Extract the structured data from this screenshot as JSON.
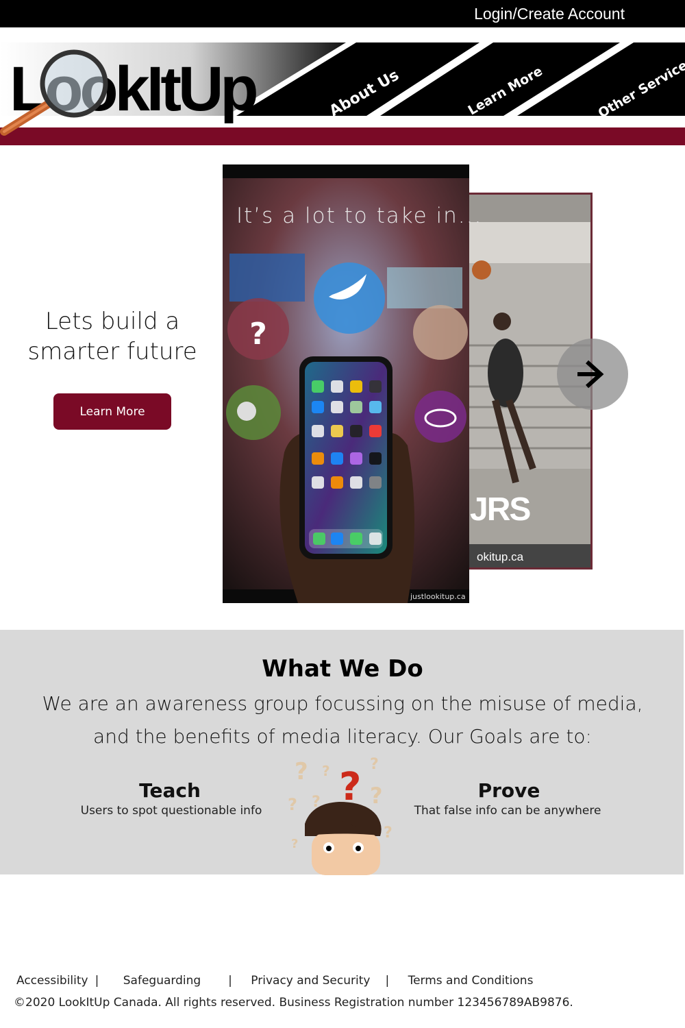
{
  "topbar": {
    "login_label": "Login/Create Account"
  },
  "header": {
    "logo_text": "LookItUp",
    "nav": [
      {
        "label": "About Us"
      },
      {
        "label": "Learn More"
      },
      {
        "label": "Other Services"
      }
    ],
    "accent_color": "#7a0a26"
  },
  "hero": {
    "headline_line1": "Lets build a",
    "headline_line2": "smarter future",
    "button_label": "Learn More",
    "slide_caption": "It’s a lot to take in...",
    "slide_watermark": "justlookitup.ca",
    "slide_back_text": "JRS",
    "slide_back_url": "okitup.ca",
    "next_icon": "arrow-right-icon"
  },
  "what_we_do": {
    "title": "What We Do",
    "text_line1": "We are an awareness group focussing on the misuse of media,",
    "text_line2": "and the benefits of media literacy. Our Goals are to:",
    "goals": [
      {
        "title": "Teach",
        "desc": "Users to spot questionable info"
      },
      {
        "title": "Prove",
        "desc": "That false info can be anywhere"
      }
    ]
  },
  "footer": {
    "links": [
      "Accessibility",
      "Safeguarding",
      "Privacy and Security",
      "Terms and Conditions"
    ],
    "separator": "|",
    "copyright": "©2020 LookItUp Canada. All rights reserved. Business Registration number 123456789AB9876."
  }
}
